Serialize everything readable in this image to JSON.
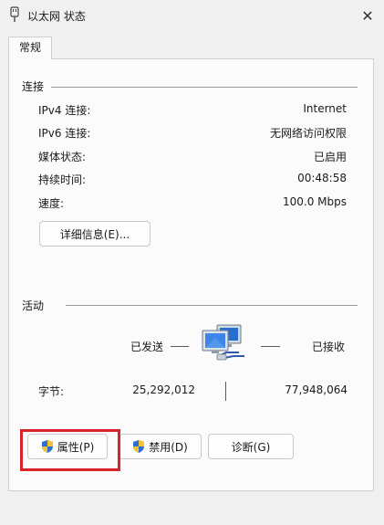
{
  "window": {
    "title": "以太网 状态",
    "close_icon": "close-icon"
  },
  "tabs": [
    {
      "label": "常规"
    }
  ],
  "connection": {
    "section_label": "连接",
    "rows": [
      {
        "label": "IPv4 连接:",
        "value": "Internet"
      },
      {
        "label": "IPv6 连接:",
        "value": "无网络访问权限"
      },
      {
        "label": "媒体状态:",
        "value": "已启用"
      },
      {
        "label": "持续时间:",
        "value": "00:48:58"
      },
      {
        "label": "速度:",
        "value": "100.0 Mbps"
      }
    ],
    "details_button": "详细信息(E)..."
  },
  "activity": {
    "section_label": "活动",
    "sent_label": "已发送",
    "received_label": "已接收",
    "bytes_label": "字节:",
    "bytes_sent": "25,292,012",
    "bytes_received": "77,948,064",
    "network_icon": "network-computers-icon"
  },
  "buttons": {
    "properties": "属性(P)",
    "disable": "禁用(D)",
    "diagnose": "诊断(G)"
  },
  "colors": {
    "highlight": "#d9232a",
    "background": "#f0f0f0",
    "panel": "#fbfbfb"
  }
}
